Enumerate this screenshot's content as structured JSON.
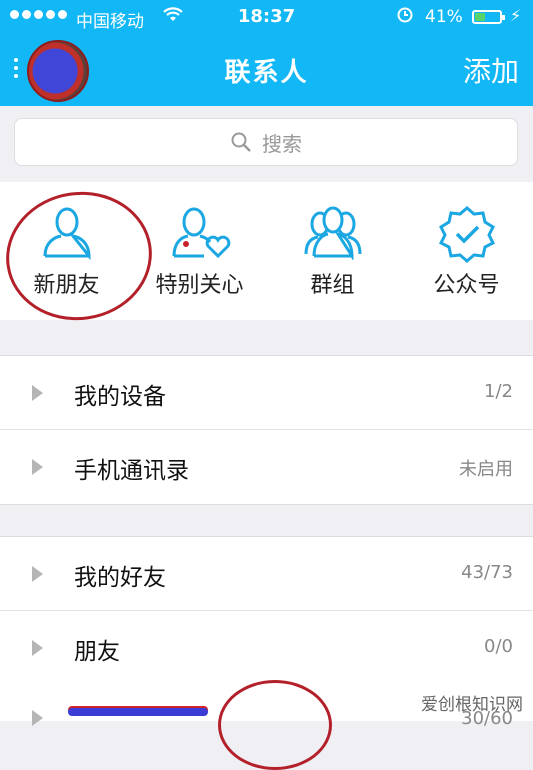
{
  "status_bar": {
    "carrier": "中国移动",
    "time": "18:37",
    "battery_percent": "41%",
    "battery_level": 0.41,
    "icons": [
      "signal-dots-icon",
      "wifi-icon",
      "alarm-icon",
      "battery-icon",
      "charging-icon"
    ]
  },
  "header": {
    "title": "联系人",
    "add_label": "添加",
    "icons": [
      "menu-dots-icon",
      "avatar"
    ]
  },
  "search": {
    "placeholder": "搜索",
    "icon": "search-icon"
  },
  "quick_entries": [
    {
      "label": "新朋友",
      "icon": "person-icon"
    },
    {
      "label": "特别关心",
      "icon": "person-heart-icon"
    },
    {
      "label": "群组",
      "icon": "group-icon"
    },
    {
      "label": "公众号",
      "icon": "badge-check-icon"
    }
  ],
  "groups_a": [
    {
      "name": "我的设备",
      "count": "1/2"
    },
    {
      "name": "手机通讯录",
      "count": "未启用"
    }
  ],
  "groups_b": [
    {
      "name": "我的好友",
      "count": "43/73"
    },
    {
      "name": "朋友",
      "count": "0/0"
    }
  ],
  "partial_row": {
    "count": "30/60"
  },
  "watermark": "爱创根知识网",
  "colors": {
    "accent": "#12b7f5",
    "annotation": "#b3202a"
  }
}
